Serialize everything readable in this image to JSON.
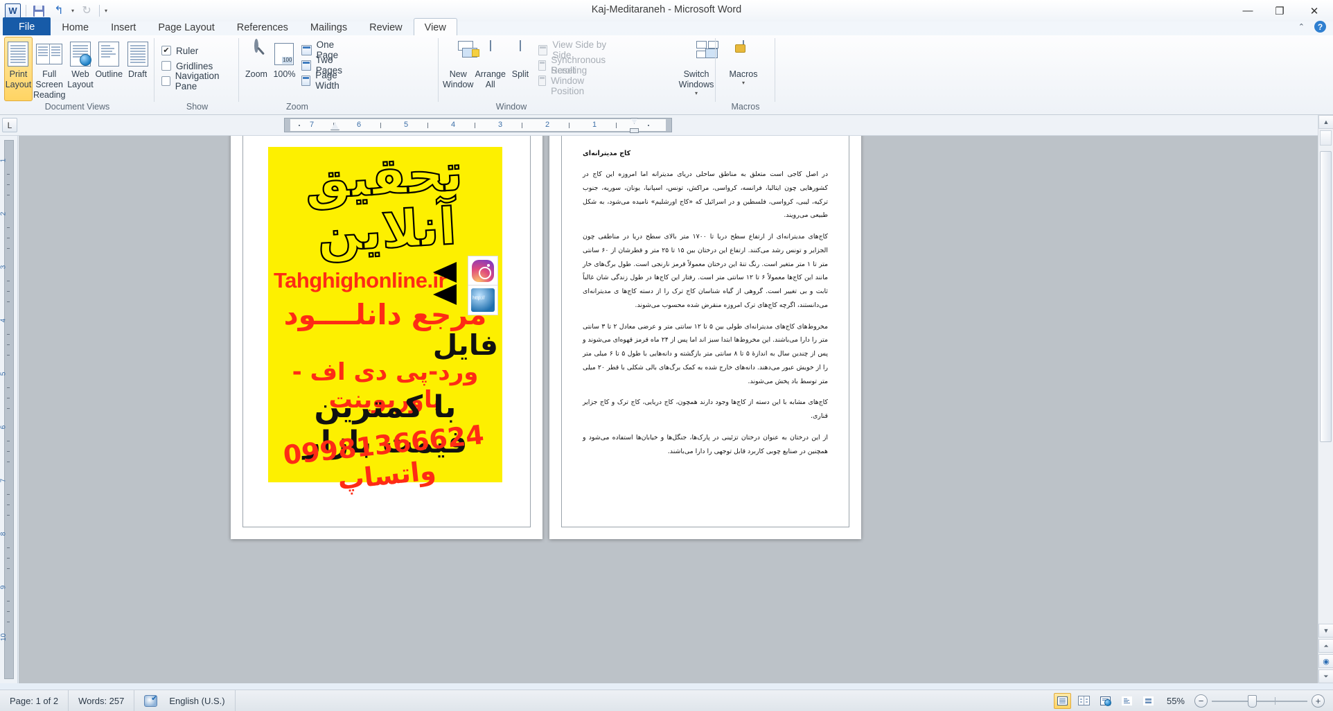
{
  "window": {
    "title": "Kaj-Meditaraneh  -  Microsoft Word",
    "minimize": "—",
    "restore": "❐",
    "close": "✕"
  },
  "quick_access": {
    "app_logo": "W",
    "save": "save-icon",
    "undo": "↰",
    "undo_dropdown": "▾",
    "redo": "↻",
    "customize": "▾"
  },
  "help_row": {
    "collapse_ribbon": "⌃",
    "help": "?"
  },
  "tabs": [
    {
      "label": "File",
      "active": false,
      "file": true
    },
    {
      "label": "Home",
      "active": false
    },
    {
      "label": "Insert",
      "active": false
    },
    {
      "label": "Page Layout",
      "active": false
    },
    {
      "label": "References",
      "active": false
    },
    {
      "label": "Mailings",
      "active": false
    },
    {
      "label": "Review",
      "active": false
    },
    {
      "label": "View",
      "active": true
    }
  ],
  "ribbon": {
    "groups": [
      {
        "name": "Document Views"
      },
      {
        "name": "Show"
      },
      {
        "name": "Zoom"
      },
      {
        "name": "Window"
      },
      {
        "name": "Macros"
      }
    ],
    "document_views": [
      {
        "label": "Print Layout",
        "selected": true
      },
      {
        "label": "Full Screen Reading",
        "selected": false
      },
      {
        "label": "Web Layout",
        "selected": false
      },
      {
        "label": "Outline",
        "selected": false
      },
      {
        "label": "Draft",
        "selected": false
      }
    ],
    "show": [
      {
        "label": "Ruler",
        "checked": true
      },
      {
        "label": "Gridlines",
        "checked": false
      },
      {
        "label": "Navigation Pane",
        "checked": false
      }
    ],
    "zoom_buttons": [
      {
        "label": "Zoom"
      },
      {
        "label": "100%"
      }
    ],
    "zoom_small": [
      {
        "label": "One Page"
      },
      {
        "label": "Two Pages"
      },
      {
        "label": "Page Width"
      }
    ],
    "window_buttons": [
      {
        "label": "New Window"
      },
      {
        "label": "Arrange All"
      },
      {
        "label": "Split"
      }
    ],
    "window_small": [
      {
        "label": "View Side by Side",
        "disabled": true
      },
      {
        "label": "Synchronous Scrolling",
        "disabled": true
      },
      {
        "label": "Reset Window Position",
        "disabled": true
      }
    ],
    "switch_windows": {
      "label": "Switch Windows",
      "dropdown": "▾"
    },
    "macros": {
      "label": "Macros",
      "dropdown": "▾"
    }
  },
  "ruler": {
    "tab_selector": "L",
    "numbers": [
      "7",
      "6",
      "5",
      "4",
      "3",
      "2",
      "1"
    ],
    "vertical_numbers": [
      "1",
      "2",
      "3",
      "4",
      "5",
      "6",
      "7",
      "8",
      "9",
      "10"
    ]
  },
  "document": {
    "ad_image": {
      "headline": "تحقیق آنلاین",
      "url": "Tahghighonline.ir",
      "line_download": "مرجع دانلــــود",
      "line_file": "فایل",
      "line_formats": "ورد-پی دی اف - پاورپوینت",
      "line_price": "با کمترین قیمت بازار",
      "line_phone": "09981366624 واتساپ",
      "badges": [
        "instagram-icon",
        "website-icon"
      ],
      "bg_color": "#fdf000",
      "red_color": "#fe2b15"
    },
    "heading": "کاج مدیترانه‌ای",
    "paragraphs": [
      "در اصل کاجی است متعلق به مناطق ساحلی دریای مدیترانه اما امروزه این کاج در کشورهایی چون ایتالیا، فرانسه، کرواسی، مراکش، تونس، اسپانیا، یونان، سوریه، جنوب ترکیه، لیبی، کرواسی، فلسطین و در اسرائیل که «کاج اورشلیم» نامیده می‌شود، به شکل طبیعی می‌رویند.",
      "کاج‌های مدیترانه‌ای از ارتفاع سطح دریا تا ۱۷۰۰ متر بالای سطح دریا در مناطقی چون الجزایر و تونس رشد می‌کنند. ارتفاع این درختان بین ۱۵ تا ۲۵ متر و قطرشان از ۶۰ سانتی متر تا ۱ متر متغیر است. رنگ تنهٔ این درختان معمولاً قرمز نارنجی است. طول برگ‌های خار مانند این کاج‌ها معمولاً ۶ تا ۱۲ سانتی متر است. رفتار این کاج‌ها در طول زندگی شان غالباً ثابت و بی تغییر است. گروهی از گیاه شناسان کاج ترک را از دسته کاج‌ها ی مدیترانه‌ای می‌دانستند، اگرچه کاج‌های ترک امروزه منقرض شده محسوب می‌شوند.",
      "مخروط‌های کاج‌های مدیترانه‌ای طولی بین ۵ تا ۱۲ سانتی متر و عرضی معادل ۲ تا ۳ سانتی متر را دارا می‌باشند. این مخروط‌ها ابتدا سبز اند اما پس از ۲۴ ماه قرمز قهوه‌ای می‌شوند و پس از چندین سال به اندازهٔ ۵ تا ۸ سانتی متر بازگشته و دانه‌هایی با طول ۵ تا ۶ میلی متر را از خویش عبور می‌دهند. دانه‌های خارج شده به کمک برگ‌های بالی شکلی با قطر ۲۰ میلی متر توسط باد پخش می‌شوند.",
      "کاج‌های مشابه با این دسته از کاج‌ها وجود دارند همچون، کاج دریایی، کاج ترک و کاج جزایر قناری.",
      "از این درختان به عنوان درختان تزئینی در پارک‌ها، جنگل‌ها و خیابان‌ها استفاده می‌شود و همچنین در صنایع چوبی کاربرد قابل توجهی را دارا می‌باشند."
    ]
  },
  "scrollbar": {
    "up_arrow": "▲",
    "down_arrow": "▼",
    "split_handle": "split-handle",
    "prev_page": "⏶",
    "next_page": "⏷"
  },
  "status_bar": {
    "page": "Page: 1 of 2",
    "words": "Words: 257",
    "proofing_icon": "spellcheck-icon",
    "language": "English (U.S.)",
    "view_buttons": [
      {
        "name": "print-layout",
        "selected": true
      },
      {
        "name": "full-screen-reading",
        "selected": false
      },
      {
        "name": "web-layout",
        "selected": false
      },
      {
        "name": "outline",
        "selected": false
      },
      {
        "name": "draft",
        "selected": false
      }
    ],
    "zoom_level": "55%",
    "zoom_out": "−",
    "zoom_in": "+"
  }
}
